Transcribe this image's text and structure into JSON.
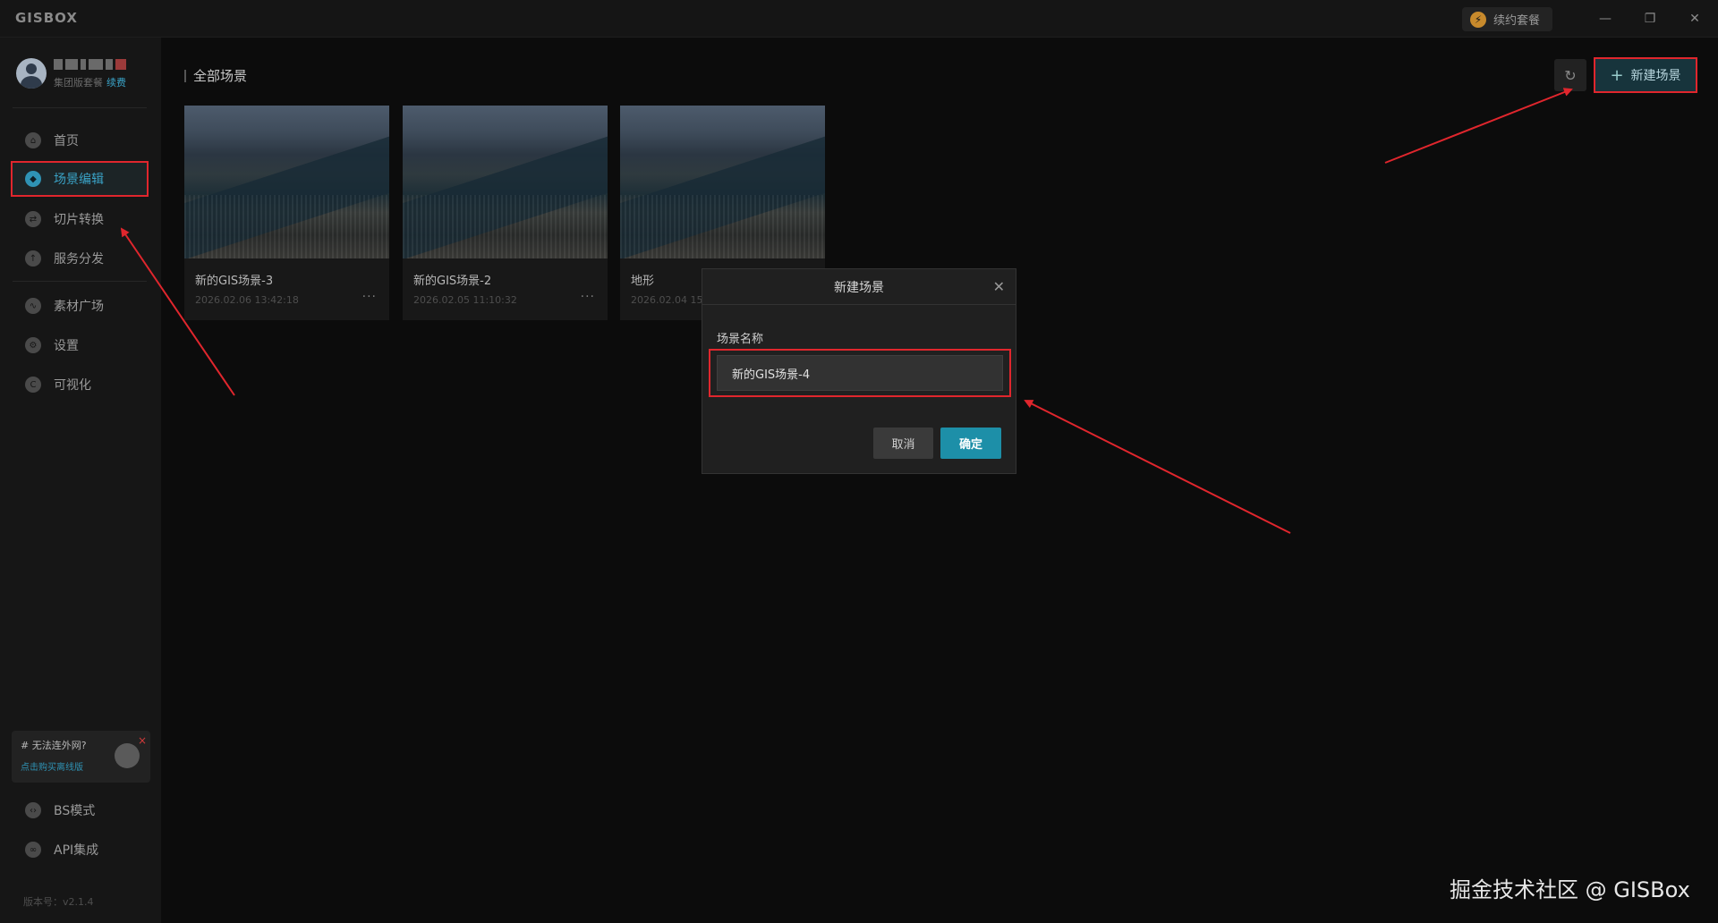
{
  "app": {
    "logo": "GISBOX",
    "renew_label": "续约套餐",
    "window_controls": {
      "minimize": "—",
      "restore": "❐",
      "close": "✕"
    }
  },
  "user": {
    "plan": "集团版套餐",
    "renew_link": "续费"
  },
  "sidebar": {
    "items": [
      {
        "label": "首页",
        "icon": "home-icon",
        "active": false
      },
      {
        "label": "场景编辑",
        "icon": "cube-icon",
        "active": true
      },
      {
        "label": "切片转换",
        "icon": "convert-icon",
        "active": false
      },
      {
        "label": "服务分发",
        "icon": "upload-icon",
        "active": false
      },
      {
        "label": "素材广场",
        "icon": "chart-icon",
        "active": false
      },
      {
        "label": "设置",
        "icon": "gear-icon",
        "active": false
      },
      {
        "label": "可视化",
        "icon": "visual-icon",
        "active": false
      }
    ],
    "offline": {
      "title": "# 无法连外网?",
      "link": "点击购买离线版"
    },
    "bottom_items": [
      {
        "label": "BS模式",
        "icon": "code-icon"
      },
      {
        "label": "API集成",
        "icon": "link-icon"
      }
    ],
    "version": "版本号：v2.1.4"
  },
  "main": {
    "breadcrumb": "全部场景",
    "new_scene_label": "新建场景",
    "cards": [
      {
        "name": "新的GIS场景-3",
        "date": "2026.02.06 13:42:18",
        "more": "···"
      },
      {
        "name": "新的GIS场景-2",
        "date": "2026.02.05 11:10:32",
        "more": "···"
      },
      {
        "name": "地形",
        "date": "2026.02.04 15:",
        "more": ""
      }
    ]
  },
  "dialog": {
    "title": "新建场景",
    "label": "场景名称",
    "input_value": "新的GIS场景-4",
    "cancel": "取消",
    "confirm": "确定"
  },
  "watermark": "掘金技术社区 @ GISBox",
  "colors": {
    "accent": "#1d8fa8",
    "highlight": "#e0262d",
    "background": "#0c0c0c"
  }
}
